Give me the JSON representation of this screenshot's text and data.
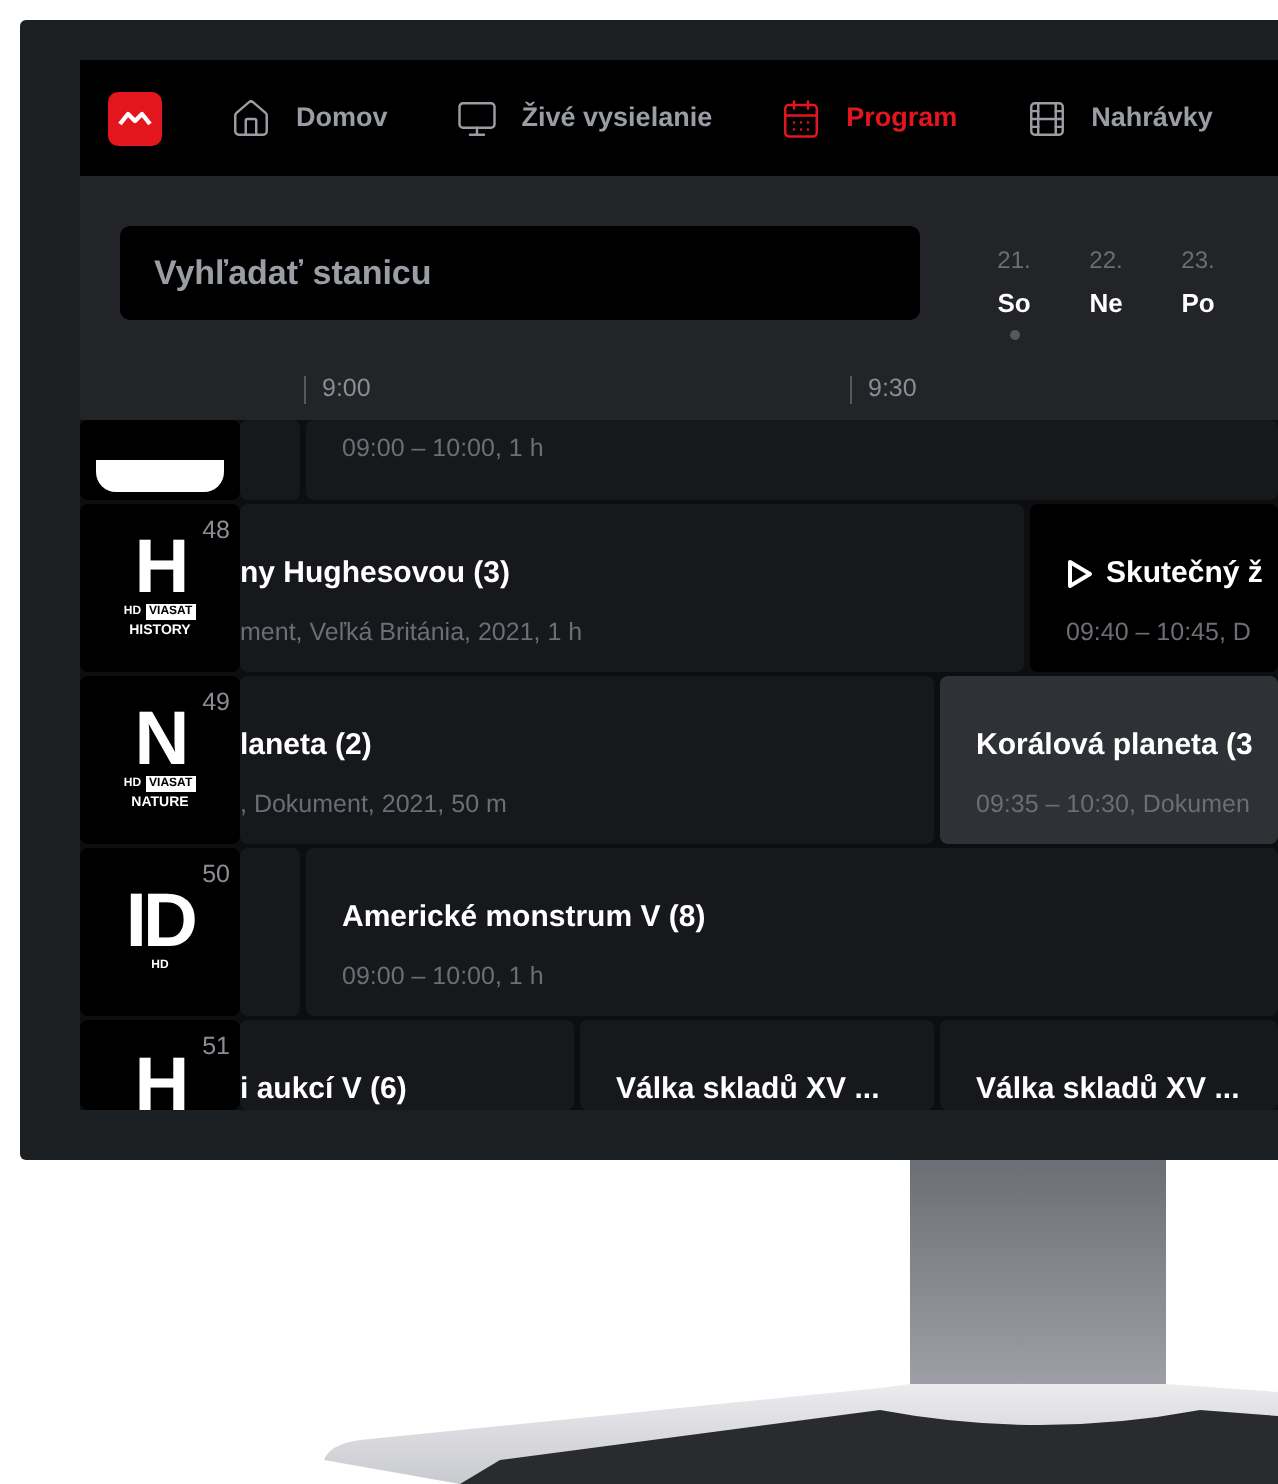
{
  "nav": [
    {
      "label": "Domov",
      "selected": false
    },
    {
      "label": "Živé vysielanie",
      "selected": false
    },
    {
      "label": "Program",
      "selected": true
    },
    {
      "label": "Nahrávky",
      "selected": false
    }
  ],
  "search": {
    "placeholder": "Vyhľadať stanicu"
  },
  "days": [
    {
      "date": "21.",
      "day": "So",
      "selected": true
    },
    {
      "date": "22.",
      "day": "Ne",
      "selected": false
    },
    {
      "date": "23.",
      "day": "Po",
      "selected": false
    }
  ],
  "timeline": [
    "9:00",
    "9:30"
  ],
  "channels": [
    {
      "logo": {
        "kind": "cut"
      },
      "programs": [
        {
          "kind": "gap"
        },
        {
          "kind": "regular",
          "selected": false,
          "info": "09:00 – 10:00, 1 h"
        }
      ]
    },
    {
      "number": "48",
      "logo": {
        "kind": "letter",
        "mark": "H",
        "tag": "HD",
        "brand": "VIASAT",
        "name": "HISTORY"
      },
      "programs": [
        {
          "kind": "regular",
          "selected": false,
          "title": "ny Hughesovou (3)",
          "info": "ment, Veľká Británia, 2021, 1 h"
        },
        {
          "kind": "play",
          "selected": false,
          "title": "Skutečný ž",
          "info": "09:40 – 10:45, D"
        }
      ]
    },
    {
      "number": "49",
      "logo": {
        "kind": "letter",
        "mark": "N",
        "tag": "HD",
        "brand": "VIASAT",
        "name": "NATURE"
      },
      "programs": [
        {
          "kind": "regular",
          "selected": false,
          "title": "laneta (2)",
          "info": ", Dokument, 2021, 50 m"
        },
        {
          "kind": "regular",
          "selected": true,
          "title": "Korálová planeta (3",
          "info": "09:35 – 10:30, Dokumen"
        }
      ]
    },
    {
      "number": "50",
      "logo": {
        "kind": "letter",
        "mark": "ID",
        "tag": "HD"
      },
      "programs": [
        {
          "kind": "gap"
        },
        {
          "kind": "regular",
          "selected": false,
          "title": "Americké monstrum V (8)",
          "info": "09:00 – 10:00, 1 h"
        }
      ]
    },
    {
      "number": "51",
      "logo": {
        "kind": "letter",
        "mark": "H"
      },
      "programs": [
        {
          "kind": "regular",
          "selected": false,
          "title": "i aukcí V (6)"
        },
        {
          "kind": "regular",
          "selected": false,
          "title": "Válka skladů XV ..."
        },
        {
          "kind": "regular",
          "selected": false,
          "title": "Válka skladů XV ..."
        }
      ]
    }
  ]
}
